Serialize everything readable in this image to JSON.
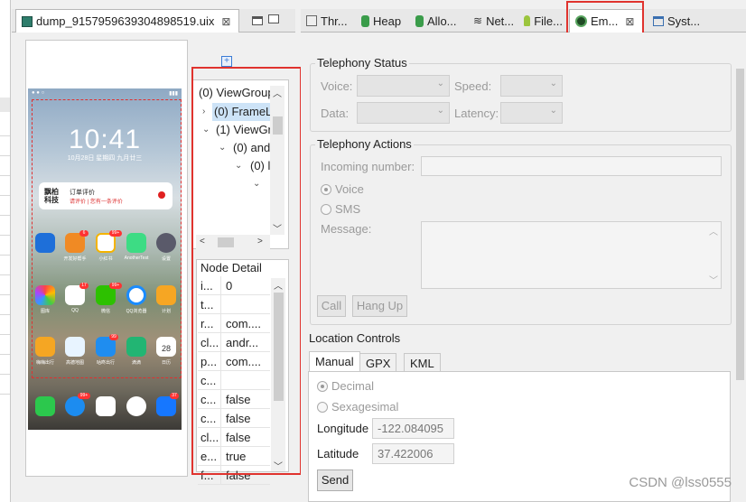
{
  "dump_tab": {
    "title": "dump_9157959639304898519.uix",
    "close": "⊠"
  },
  "right_tabs": [
    {
      "label": "Thr..."
    },
    {
      "label": "Heap"
    },
    {
      "label": "Allo..."
    },
    {
      "label": "Net..."
    },
    {
      "label": "File..."
    },
    {
      "label": "Em...",
      "close": "⊠"
    },
    {
      "label": "Syst..."
    }
  ],
  "phone": {
    "clock": "10:41",
    "date": "10月28日 星期四 九月廿三",
    "notification": {
      "app": "飘柏科技",
      "title": "订单评价",
      "subtitle": "请评价 | 您有一条评价"
    },
    "apps_row1": [
      "",
      "开发好帮手",
      "小红书",
      "AnotherTest",
      "设置"
    ],
    "apps_row2": [
      "图库",
      "QQ",
      "微信",
      "QQ浏览器",
      "计划"
    ],
    "apps_row3": [
      "嗨嗨出行",
      "高德地图",
      "咕咚出行",
      "滴滴",
      "日历"
    ],
    "badges": {
      "app2": "6",
      "app3": "99+",
      "qq": "17",
      "wechat": "99+",
      "haha": "99",
      "msg": "99+",
      "alipay": "37"
    },
    "calendar_day": "28"
  },
  "tree": {
    "nodes": [
      {
        "label": "(0) ViewGroup",
        "twisty": ""
      },
      {
        "label": "(0) FrameL",
        "twisty": "›",
        "selected": true
      },
      {
        "label": "(1) ViewGr",
        "twisty": "⌄"
      },
      {
        "label": "(0) and",
        "twisty": "⌄"
      },
      {
        "label": "(0) l",
        "twisty": "⌄"
      },
      {
        "label": "",
        "twisty": "⌄"
      }
    ]
  },
  "node_detail": {
    "header": "Node Detail",
    "rows": [
      {
        "k": "i...",
        "v": "0"
      },
      {
        "k": "t...",
        "v": ""
      },
      {
        "k": "r...",
        "v": "com...."
      },
      {
        "k": "cl...",
        "v": "andr..."
      },
      {
        "k": "p...",
        "v": "com...."
      },
      {
        "k": "c...",
        "v": ""
      },
      {
        "k": "c...",
        "v": "false"
      },
      {
        "k": "c...",
        "v": "false"
      },
      {
        "k": "cl...",
        "v": "false"
      },
      {
        "k": "e...",
        "v": "true"
      },
      {
        "k": "f...",
        "v": "false"
      }
    ]
  },
  "telephony_status": {
    "title": "Telephony Status",
    "voice_label": "Voice:",
    "speed_label": "Speed:",
    "data_label": "Data:",
    "latency_label": "Latency:"
  },
  "telephony_actions": {
    "title": "Telephony Actions",
    "incoming_label": "Incoming number:",
    "voice_radio": "Voice",
    "sms_radio": "SMS",
    "message_label": "Message:",
    "call_button": "Call",
    "hangup_button": "Hang Up"
  },
  "location": {
    "title": "Location Controls",
    "tabs": [
      "Manual",
      "GPX",
      "KML"
    ],
    "decimal_radio": "Decimal",
    "sexagesimal_radio": "Sexagesimal",
    "longitude_label": "Longitude",
    "longitude_value": "-122.084095",
    "latitude_label": "Latitude",
    "latitude_value": "37.422006",
    "send_button": "Send"
  },
  "watermark": "CSDN @lss0555",
  "colors": {
    "highlight": "#e0332e",
    "selection": "#cde3f7"
  }
}
